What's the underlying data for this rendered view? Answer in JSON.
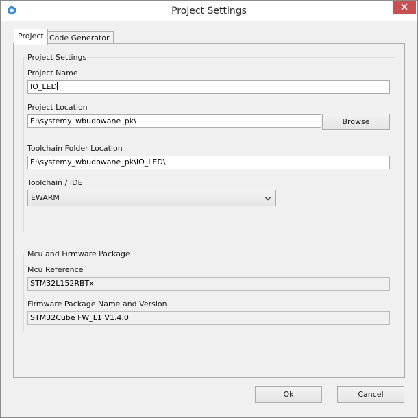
{
  "window": {
    "title": "Project Settings",
    "close_icon": "close-icon",
    "app_icon": "stm32cube-app-icon"
  },
  "tabs": [
    {
      "label": "Project",
      "active": true
    },
    {
      "label": "Code Generator",
      "active": false
    }
  ],
  "project_settings": {
    "group_title": "Project Settings",
    "project_name": {
      "label": "Project Name",
      "value": "IO_LED"
    },
    "project_location": {
      "label": "Project Location",
      "value": "E:\\systemy_wbudowane_pk\\",
      "browse_label": "Browse"
    },
    "toolchain_folder": {
      "label": "Toolchain Folder Location",
      "value": "E:\\systemy_wbudowane_pk\\IO_LED\\"
    },
    "toolchain_ide": {
      "label": "Toolchain / IDE",
      "selected": "EWARM"
    }
  },
  "mcu_package": {
    "group_title": "Mcu and Firmware Package",
    "mcu_reference": {
      "label": "Mcu Reference",
      "value": "STM32L152RBTx"
    },
    "firmware_package": {
      "label": "Firmware Package Name and Version",
      "value": "STM32Cube FW_L1 V1.4.0"
    }
  },
  "footer": {
    "ok_label": "Ok",
    "cancel_label": "Cancel"
  },
  "colors": {
    "close_button_bg": "#c75050",
    "window_bg": "#f0f0f0"
  }
}
